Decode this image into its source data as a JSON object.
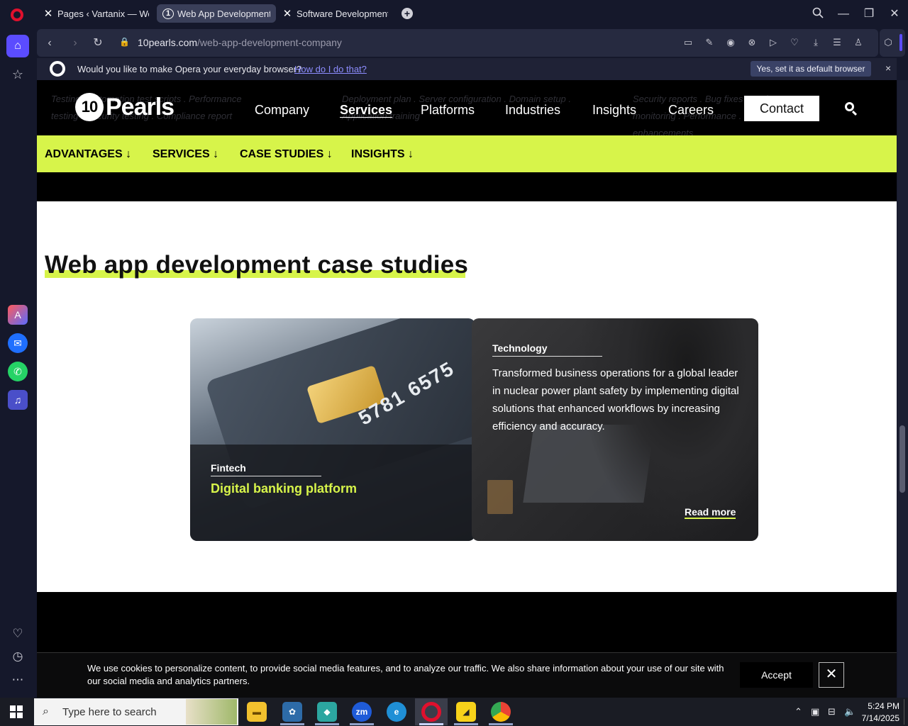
{
  "browser": {
    "tabs": [
      {
        "label": "Pages ‹ Vartanix — WordP",
        "icon": "x-logo-icon",
        "active": false
      },
      {
        "label": "Web App Development Co",
        "icon": "10pearls-favicon",
        "active": true
      },
      {
        "label": "Software Development & ",
        "icon": "x-logo-icon",
        "active": false
      }
    ],
    "url_domain": "10pearls.com",
    "url_path": "/web-app-development-company",
    "prompt": {
      "question": "Would you like to make Opera your everyday browser?",
      "link": "How do I do that?",
      "button": "Yes, set it as default browser",
      "close": "×"
    }
  },
  "site": {
    "logo": "Pearls",
    "logo_mark": "10",
    "nav": [
      {
        "label": "Company",
        "active": false
      },
      {
        "label": "Services",
        "active": true
      },
      {
        "label": "Platforms",
        "active": false
      },
      {
        "label": "Industries",
        "active": false
      },
      {
        "label": "Insights",
        "active": false
      },
      {
        "label": "Careers",
        "active": false
      }
    ],
    "contact": "Contact",
    "ghost_text": [
      "Testing . Automation test scripts . Performance",
      "testing . Security testing . Compliance report",
      "Deployment plan . Server configuration . Domain setup .",
      "Application training",
      "Security reports . Bug fixes . Performance",
      "monitoring . Performance . Security",
      "enhancements"
    ],
    "subnav": [
      "ADVANTAGES ↓",
      "SERVICES ↓",
      "CASE STUDIES ↓",
      "INSIGHTS ↓"
    ],
    "section_title": "Web app development case studies",
    "cards": [
      {
        "category": "Fintech",
        "title": "Digital banking platform",
        "card_number": "5781 6575"
      },
      {
        "category": "Technology",
        "description": "Transformed business operations for a global leader in nuclear power plant safety by implementing digital solutions that enhanced workflows by increasing efficiency and accuracy.",
        "cta": "Read more"
      }
    ],
    "cookie": {
      "text": "We use cookies to personalize content, to provide social media features, and to analyze our traffic. We also share information about your use of our site with our social media and analytics partners.",
      "accept": "Accept"
    }
  },
  "taskbar": {
    "search_placeholder": "Type here to search",
    "time": "5:24 PM",
    "date": "7/14/2025",
    "apps": [
      "file-explorer-icon",
      "paint-icon",
      "app-icon",
      "zoom-icon",
      "edge-icon",
      "opera-icon",
      "sticky-notes-icon",
      "chrome-icon"
    ]
  },
  "colors": {
    "accent_lime": "#d7f44a",
    "opera_red": "#e0102d",
    "opera_purple": "#5b4cff"
  }
}
